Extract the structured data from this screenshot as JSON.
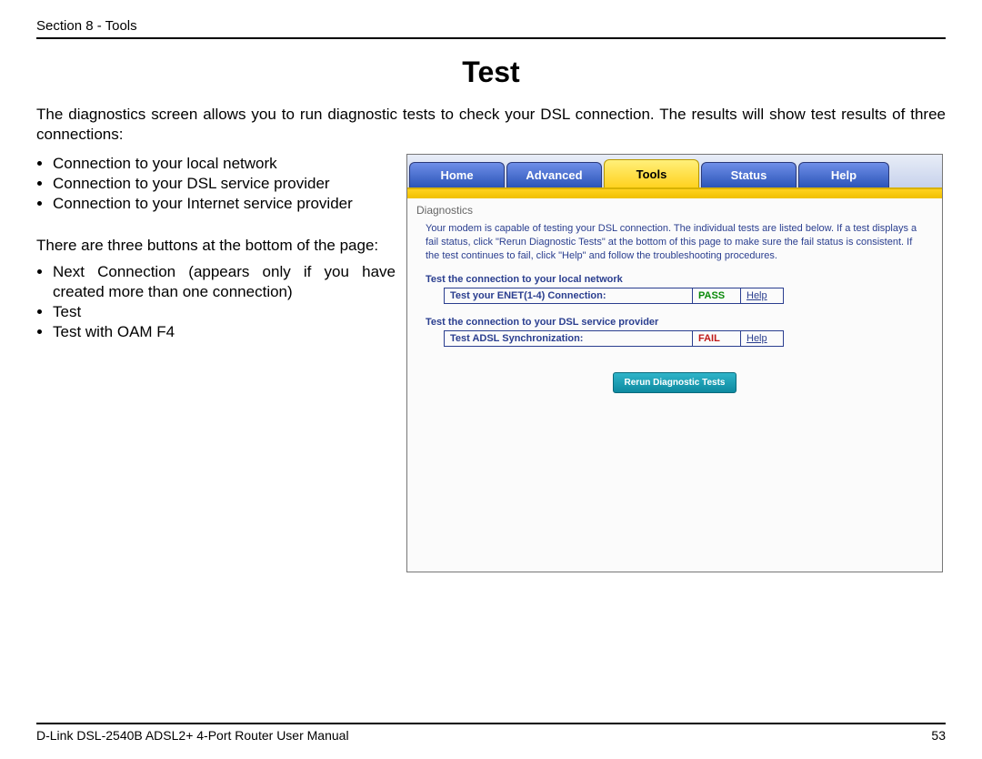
{
  "header": {
    "section": "Section 8 - Tools"
  },
  "title": "Test",
  "intro": "The diagnostics screen allows you to run diagnostic tests to check your DSL connection. The results will show test results of three connections:",
  "bullets1": {
    "b0": "Connection to your local network",
    "b1": "Connection to your DSL service provider",
    "b2": "Connection to your Internet service provider"
  },
  "mid_text": "There are three buttons at the bottom of the page:",
  "bullets2": {
    "b0": "Next Connection (appears only if you have created more than one connection)",
    "b1": "Test",
    "b2": "Test with OAM F4"
  },
  "tabs": {
    "home": "Home",
    "advanced": "Advanced",
    "tools": "Tools",
    "status": "Status",
    "help": "Help"
  },
  "panel": {
    "title": "Diagnostics",
    "desc": "Your modem is capable of testing your DSL connection. The individual tests are listed below. If a test displays a fail status, click \"Rerun Diagnostic Tests\" at the bottom of this page to make sure the fail status is consistent. If the test continues to fail, click \"Help\" and follow the troubleshooting procedures.",
    "section1": "Test the connection to your local network",
    "test1_label": "Test your ENET(1-4) Connection:",
    "test1_status": "PASS",
    "section2": "Test the connection to your DSL service provider",
    "test2_label": "Test ADSL Synchronization:",
    "test2_status": "FAIL",
    "help_link": "Help",
    "button": "Rerun Diagnostic Tests"
  },
  "footer": {
    "manual": "D-Link DSL-2540B ADSL2+ 4-Port Router User Manual",
    "page": "53"
  }
}
